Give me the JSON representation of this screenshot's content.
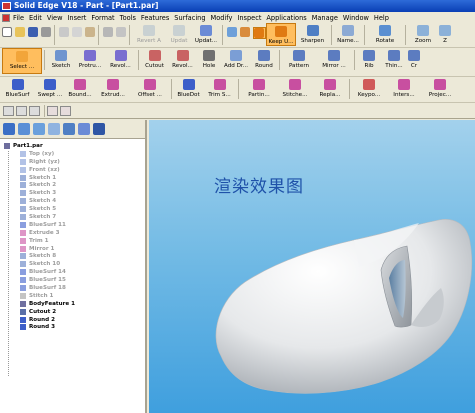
{
  "window": {
    "title": "Solid Edge V18 - Part - [Part1.par]"
  },
  "menu": [
    "File",
    "Edit",
    "View",
    "Insert",
    "Format",
    "Tools",
    "Features",
    "Surfacing",
    "Modify",
    "Inspect",
    "Applications",
    "Manage",
    "Window",
    "Help"
  ],
  "toolbar1": {
    "buttons": [
      "Revert A",
      "Updat",
      "Updat...",
      "Sharpen",
      "Name...",
      "Rotate",
      "Zoom",
      "Z"
    ],
    "active": "Keep U...",
    "disabled": [
      "Revert A",
      "Updat"
    ]
  },
  "toolbar2": {
    "buttons": [
      "Select ...",
      "Sketch",
      "Protru...",
      "Revol...",
      "Cutout",
      "Revol...",
      "Hole",
      "Add Dr...",
      "Round",
      "Pattern",
      "Mirror ...",
      "Rib",
      "Thin...",
      "Cr"
    ]
  },
  "toolbar3": {
    "buttons": [
      "BlueSurf",
      "Swept ...",
      "Bound...",
      "Extrud...",
      "Offset ...",
      "BlueDot",
      "Trim S...",
      "Partin...",
      "Stitche...",
      "Repla...",
      "Keypo...",
      "Inters...",
      "Projec..."
    ]
  },
  "pane_tabs": [
    "edgebar-tab-feature",
    "edgebar-tab-layers",
    "edgebar-tab-library",
    "edgebar-tab-family",
    "edgebar-tab-pathfinder",
    "edgebar-tab-sensor",
    "edgebar-tab-feature-library"
  ],
  "tree": {
    "root": "Part1.par",
    "items": [
      {
        "label": "Top (xy)",
        "style": "grey",
        "icon": "plane"
      },
      {
        "label": "Right (yz)",
        "style": "grey",
        "icon": "plane"
      },
      {
        "label": "Front (xz)",
        "style": "grey",
        "icon": "plane"
      },
      {
        "label": "Sketch 1",
        "style": "grey",
        "icon": "sketch"
      },
      {
        "label": "Sketch 2",
        "style": "grey",
        "icon": "sketch"
      },
      {
        "label": "Sketch 3",
        "style": "grey",
        "icon": "sketch"
      },
      {
        "label": "Sketch 4",
        "style": "grey",
        "icon": "sketch"
      },
      {
        "label": "Sketch 5",
        "style": "grey",
        "icon": "sketch"
      },
      {
        "label": "Sketch 7",
        "style": "grey",
        "icon": "sketch"
      },
      {
        "label": "BlueSurf 11",
        "style": "grey",
        "icon": "bluesurf"
      },
      {
        "label": "Extrude 3",
        "style": "grey",
        "icon": "extrude"
      },
      {
        "label": "Trim 1",
        "style": "grey",
        "icon": "trim"
      },
      {
        "label": "Mirror 1",
        "style": "grey",
        "icon": "mirror"
      },
      {
        "label": "Sketch 8",
        "style": "grey",
        "icon": "sketch"
      },
      {
        "label": "Sketch 10",
        "style": "grey",
        "icon": "sketch"
      },
      {
        "label": "BlueSurf 14",
        "style": "grey",
        "icon": "bluesurf"
      },
      {
        "label": "BlueSurf 15",
        "style": "grey",
        "icon": "bluesurf"
      },
      {
        "label": "BlueSurf 18",
        "style": "grey",
        "icon": "bluesurf"
      },
      {
        "label": "Stitch 1",
        "style": "grey",
        "icon": "stitch"
      },
      {
        "label": "BodyFeature 1",
        "style": "normal",
        "icon": "body"
      },
      {
        "label": "Cutout 2",
        "style": "normal",
        "icon": "cutout"
      },
      {
        "label": "Round 2",
        "style": "normal",
        "icon": "round"
      },
      {
        "label": "Round 3",
        "style": "normal",
        "icon": "round"
      }
    ]
  },
  "viewport": {
    "overlay_text": "渲染效果图"
  },
  "colors": {
    "title_bar": "#0a3fb5",
    "viewport_top": "#a3d1ec",
    "viewport_bottom": "#3f9fde",
    "active_tool": "#ffbe5e",
    "overlay_text": "#1f52a9",
    "grey_tree_text": "#9c9c9c"
  }
}
